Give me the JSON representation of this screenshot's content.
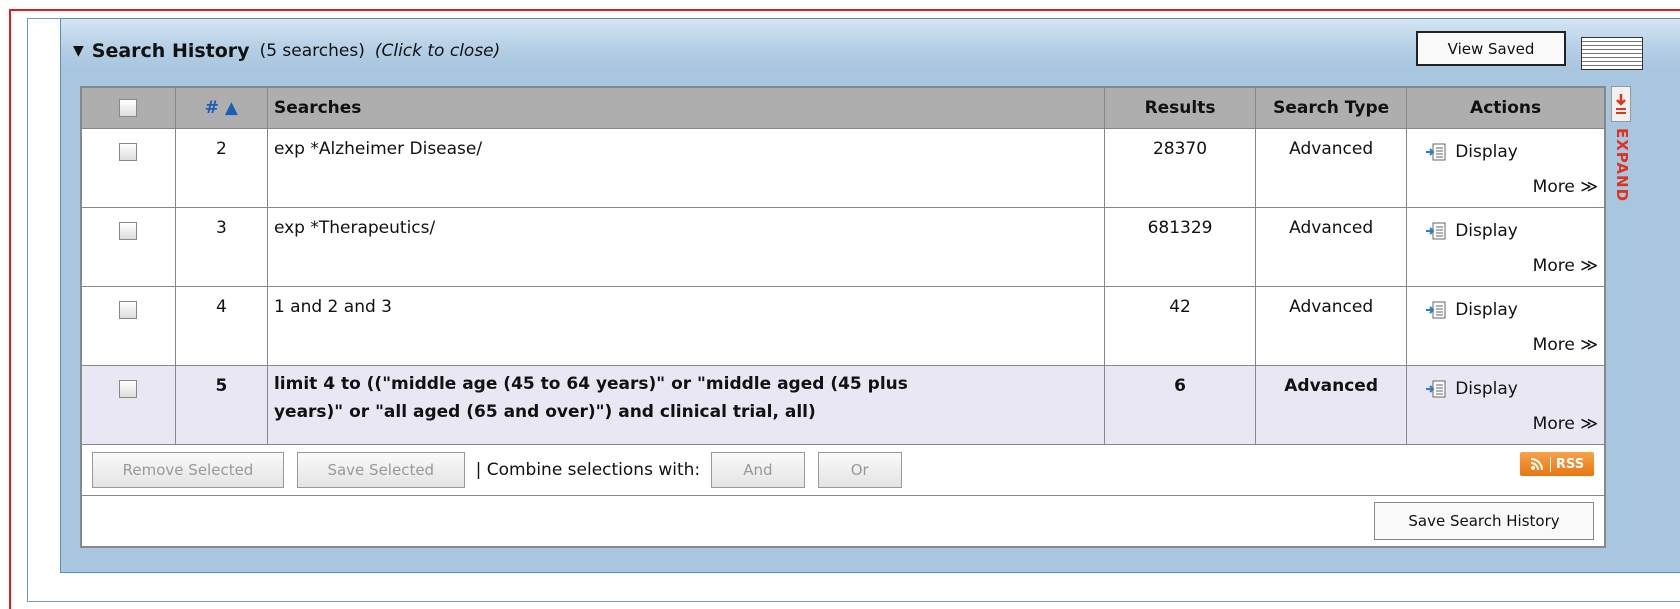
{
  "header": {
    "title": "Search History",
    "count": "(5 searches)",
    "toggle_label": "(Click to close)"
  },
  "toolbar": {
    "view_saved_label": "View Saved"
  },
  "table": {
    "columns": {
      "num": "# ▲",
      "searches": "Searches",
      "results": "Results",
      "type": "Search Type",
      "actions": "Actions"
    },
    "rows": [
      {
        "num": "2",
        "search": "exp *Alzheimer Disease/",
        "results": "28370",
        "type": "Advanced",
        "display": "Display",
        "more": "More ≫"
      },
      {
        "num": "3",
        "search": "exp *Therapeutics/",
        "results": "681329",
        "type": "Advanced",
        "display": "Display",
        "more": "More ≫"
      },
      {
        "num": "4",
        "search": "1 and 2 and 3",
        "results": "42",
        "type": "Advanced",
        "display": "Display",
        "more": "More ≫"
      },
      {
        "num": "5",
        "search": "limit 4 to ((\"middle age (45 to 64 years)\" or \"middle aged (45 plus years)\" or \"all aged (65 and over)\") and clinical trial, all)",
        "results": "6",
        "type": "Advanced",
        "display": "Display",
        "more": "More ≫"
      }
    ]
  },
  "actions_bar": {
    "remove_selected": "Remove Selected",
    "save_selected": "Save Selected",
    "combine_label": "| Combine selections with:",
    "and_label": "And",
    "or_label": "Or",
    "rss_label": "RSS"
  },
  "footer": {
    "save_history_label": "Save Search History"
  },
  "expand": {
    "label": "EXPAND"
  },
  "colors": {
    "frame_border": "#e11b1b",
    "panel_bg": "#a8c6df",
    "header_row": "#aeaeae",
    "highlight_row": "#e9e7f3",
    "expand_accent": "#e0331d",
    "rss_orange": "#f08a24",
    "sort_link": "#1a5fb4"
  }
}
